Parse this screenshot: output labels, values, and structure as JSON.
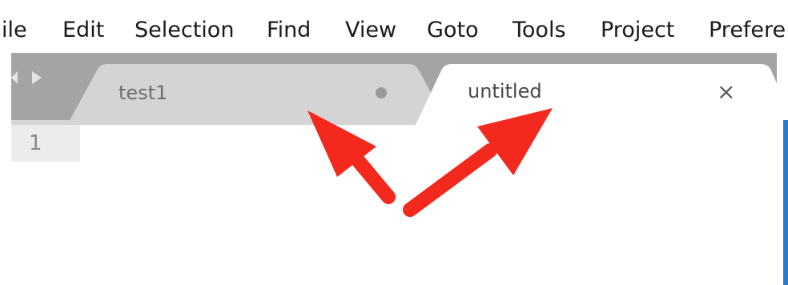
{
  "menu": {
    "items": [
      "ile",
      "Edit",
      "Selection",
      "Find",
      "View",
      "Goto",
      "Tools",
      "Project",
      "Prefere"
    ]
  },
  "tabs": [
    {
      "label": "test1",
      "state": "inactive",
      "indicator": "dirty-dot-icon"
    },
    {
      "label": "untitled",
      "state": "active",
      "indicator": "close-icon",
      "indicator_glyph": "×"
    }
  ],
  "editor": {
    "line_numbers": [
      "1"
    ]
  },
  "colors": {
    "tabstrip": "#a4a4a4",
    "inactive_tab": "#d4d4d4",
    "active_tab": "#ffffff",
    "gutter": "#ececec",
    "annotation_arrow": "#f2291c",
    "accent": "#2b7bd6"
  },
  "annotations": {
    "arrows": [
      {
        "points_to": "tab-test1",
        "color": "#f2291c"
      },
      {
        "points_to": "tab-untitled",
        "color": "#f2291c"
      }
    ]
  }
}
